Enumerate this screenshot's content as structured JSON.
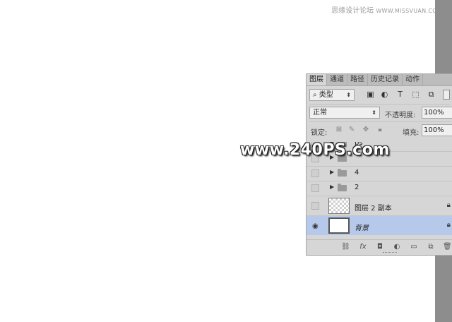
{
  "watermark_top": {
    "cn": "思缘设计论坛",
    "site": "WWW.MISSVUAN.COM"
  },
  "watermark_center": "www.240PS.com",
  "panel": {
    "tabs": [
      {
        "label": "图层",
        "active": true
      },
      {
        "label": "通道",
        "active": false
      },
      {
        "label": "路径",
        "active": false
      },
      {
        "label": "历史记录",
        "active": false
      },
      {
        "label": "动作",
        "active": false
      }
    ],
    "filter": {
      "kind_label": "类型",
      "search_icon": "search-icon"
    },
    "blend_mode": "正常",
    "opacity_label": "不透明度:",
    "opacity_value": "100%",
    "lock_label": "锁定:",
    "fill_label": "填充:",
    "fill_value": "100%",
    "layers": [
      {
        "name": "ps",
        "type": "group"
      },
      {
        "name": "4",
        "type": "group"
      },
      {
        "name": "2",
        "type": "group"
      },
      {
        "name": "图层 2 副本",
        "type": "layer",
        "locked": true
      },
      {
        "name": "背景",
        "type": "background",
        "locked": true,
        "visible": true,
        "selected": true
      }
    ]
  },
  "colors": {
    "selected_row": "#b6c9ea",
    "panel_bg": "#d6d6d6",
    "strip": "#8d8d8d"
  }
}
